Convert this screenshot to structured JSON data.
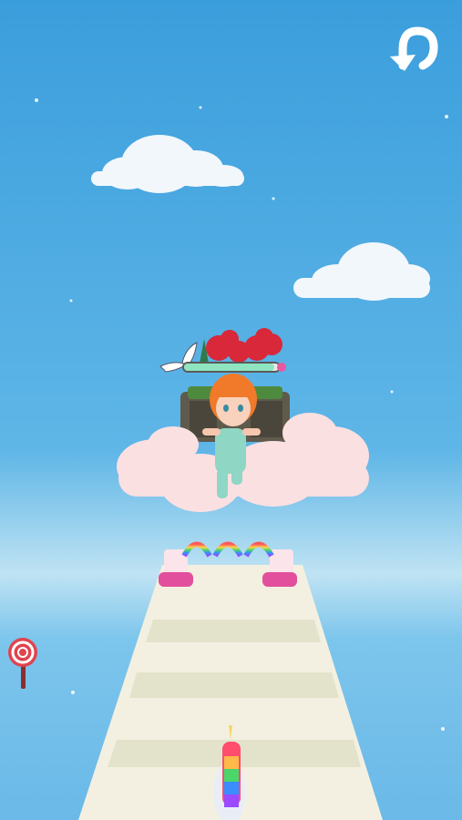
{
  "game": {
    "progress_fraction": 0.95,
    "controls": {
      "restart_icon": "restart-arrow-icon"
    },
    "colors": {
      "sky_top": "#3d9fdc",
      "track": "#f4f0e1",
      "track_stripe": "#e2e2c8",
      "progress_fill": "#8fe5c0",
      "accent_pink": "#e85aa0",
      "hair": "#f07a2a",
      "outfit": "#8fd6c4"
    }
  }
}
